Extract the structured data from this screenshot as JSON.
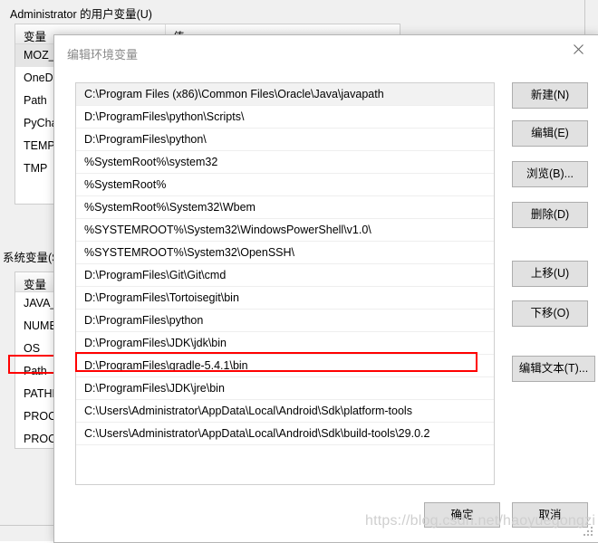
{
  "background_window": {
    "user_vars_label": "Administrator 的用户变量(U)",
    "system_vars_label": "系统变量(S)",
    "columns": {
      "variable": "变量",
      "value": "值"
    },
    "user_vars": [
      {
        "name": "MOZ_PL",
        "selected": true
      },
      {
        "name": "OneDriv",
        "selected": false
      },
      {
        "name": "Path",
        "selected": false
      },
      {
        "name": "PyCharm",
        "selected": false
      },
      {
        "name": "TEMP",
        "selected": false
      },
      {
        "name": "TMP",
        "selected": false
      }
    ],
    "system_vars": [
      {
        "name": "JAVA_H",
        "highlighted": false
      },
      {
        "name": "NUMBE",
        "highlighted": false
      },
      {
        "name": "OS",
        "highlighted": false
      },
      {
        "name": "Path",
        "highlighted": true
      },
      {
        "name": "PATHEX",
        "highlighted": false
      },
      {
        "name": "PROCES",
        "highlighted": false
      },
      {
        "name": "PROCES",
        "highlighted": false
      }
    ]
  },
  "edit_dialog": {
    "title": "编辑环境变量",
    "close_icon": "close-icon",
    "paths": [
      {
        "value": "C:\\Program Files (x86)\\Common Files\\Oracle\\Java\\javapath",
        "selected": true,
        "highlighted": false
      },
      {
        "value": "D:\\ProgramFiles\\python\\Scripts\\",
        "selected": false,
        "highlighted": false
      },
      {
        "value": "D:\\ProgramFiles\\python\\",
        "selected": false,
        "highlighted": false
      },
      {
        "value": "%SystemRoot%\\system32",
        "selected": false,
        "highlighted": false
      },
      {
        "value": "%SystemRoot%",
        "selected": false,
        "highlighted": false
      },
      {
        "value": "%SystemRoot%\\System32\\Wbem",
        "selected": false,
        "highlighted": false
      },
      {
        "value": "%SYSTEMROOT%\\System32\\WindowsPowerShell\\v1.0\\",
        "selected": false,
        "highlighted": false
      },
      {
        "value": "%SYSTEMROOT%\\System32\\OpenSSH\\",
        "selected": false,
        "highlighted": false
      },
      {
        "value": "D:\\ProgramFiles\\Git\\Git\\cmd",
        "selected": false,
        "highlighted": false
      },
      {
        "value": "D:\\ProgramFiles\\Tortoisegit\\bin",
        "selected": false,
        "highlighted": false
      },
      {
        "value": "D:\\ProgramFiles\\python",
        "selected": false,
        "highlighted": false
      },
      {
        "value": "D:\\ProgramFiles\\JDK\\jdk\\bin",
        "selected": false,
        "highlighted": false
      },
      {
        "value": "D:\\ProgramFiles\\gradle-5.4.1\\bin",
        "selected": false,
        "highlighted": false
      },
      {
        "value": "D:\\ProgramFiles\\JDK\\jre\\bin",
        "selected": false,
        "highlighted": false
      },
      {
        "value": "C:\\Users\\Administrator\\AppData\\Local\\Android\\Sdk\\platform-tools",
        "selected": false,
        "highlighted": true
      },
      {
        "value": "C:\\Users\\Administrator\\AppData\\Local\\Android\\Sdk\\build-tools\\29.0.2",
        "selected": false,
        "highlighted": false
      }
    ],
    "side_buttons": [
      {
        "label": "新建(N)"
      },
      {
        "label": "编辑(E)"
      },
      {
        "label": "浏览(B)..."
      },
      {
        "label": "删除(D)"
      },
      {
        "label": "上移(U)"
      },
      {
        "label": "下移(O)"
      },
      {
        "label": "编辑文本(T)..."
      }
    ],
    "ok_label": "确定",
    "cancel_label": "取消"
  },
  "watermark": "https://blog.csdn.net/haoyuegongzi",
  "colors": {
    "annotation_red": "#ff0000",
    "dialog_bg": "#ffffff",
    "window_bg": "#f0f0f0",
    "button_face": "#e1e1e1",
    "selection": "#e5e5e5"
  }
}
